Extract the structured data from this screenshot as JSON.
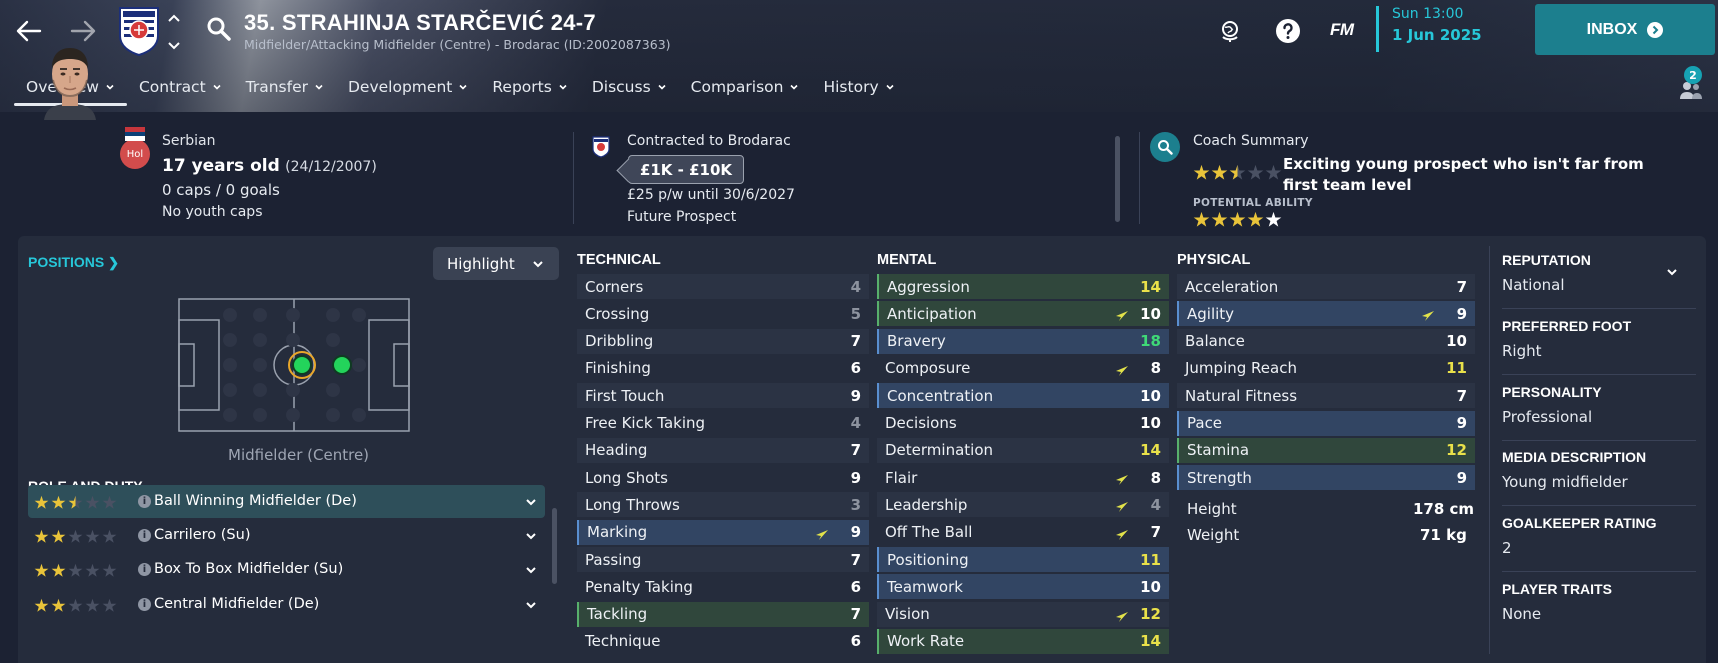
{
  "header": {
    "player_title": "35. STRAHINJA STARČEVIĆ 24-7",
    "player_subtitle": "Midfielder/Attacking Midfielder (Centre) - Brodarac (ID:2002087363)",
    "fm_logo": "FM",
    "date_time": "Sun 13:00",
    "date_day": "1 Jun 2025",
    "inbox_label": "INBOX",
    "notification_count": "2",
    "tabs": [
      {
        "label": "Overview",
        "active": true
      },
      {
        "label": "Contract"
      },
      {
        "label": "Transfer"
      },
      {
        "label": "Development"
      },
      {
        "label": "Reports"
      },
      {
        "label": "Discuss"
      },
      {
        "label": "Comparison"
      },
      {
        "label": "History"
      }
    ]
  },
  "info": {
    "hol_badge": "Hol",
    "nationality": "Serbian",
    "age": "17 years old",
    "dob": "(24/12/2007)",
    "caps": "0 caps / 0 goals",
    "youth_caps": "No youth caps",
    "contracted": "Contracted to Brodarac",
    "wage_range": "£1K - £10K",
    "wage_line": "£25 p/w until 30/6/2027",
    "status": "Future Prospect",
    "coach_summary_label": "Coach Summary",
    "coach_quote": "Exciting young prospect who isn't far from first team level",
    "current_ability_stars": 2.5,
    "potential_label": "POTENTIAL ABILITY",
    "potential_ability_stars": 4.5
  },
  "positions": {
    "link_label": "POSITIONS",
    "highlight_label": "Highlight",
    "position_label": "Midfielder (Centre)",
    "role_title": "ROLE AND DUTY",
    "roles": [
      {
        "name": "Ball Winning Midfielder (De)",
        "stars": 2.5
      },
      {
        "name": "Carrilero (Su)",
        "stars": 2
      },
      {
        "name": "Box To Box Midfielder (Su)",
        "stars": 2
      },
      {
        "name": "Central Midfielder (De)",
        "stars": 2
      }
    ]
  },
  "technical": {
    "title": "TECHNICAL",
    "attrs": [
      {
        "name": "Corners",
        "value": "4"
      },
      {
        "name": "Crossing",
        "value": "5"
      },
      {
        "name": "Dribbling",
        "value": "7"
      },
      {
        "name": "Finishing",
        "value": "6"
      },
      {
        "name": "First Touch",
        "value": "9"
      },
      {
        "name": "Free Kick Taking",
        "value": "4"
      },
      {
        "name": "Heading",
        "value": "7"
      },
      {
        "name": "Long Shots",
        "value": "9"
      },
      {
        "name": "Long Throws",
        "value": "3"
      },
      {
        "name": "Marking",
        "value": "9"
      },
      {
        "name": "Passing",
        "value": "7"
      },
      {
        "name": "Penalty Taking",
        "value": "6"
      },
      {
        "name": "Tackling",
        "value": "7"
      },
      {
        "name": "Technique",
        "value": "6"
      }
    ]
  },
  "mental": {
    "title": "MENTAL",
    "attrs": [
      {
        "name": "Aggression",
        "value": "14"
      },
      {
        "name": "Anticipation",
        "value": "10"
      },
      {
        "name": "Bravery",
        "value": "18"
      },
      {
        "name": "Composure",
        "value": "8"
      },
      {
        "name": "Concentration",
        "value": "10"
      },
      {
        "name": "Decisions",
        "value": "10"
      },
      {
        "name": "Determination",
        "value": "14"
      },
      {
        "name": "Flair",
        "value": "8"
      },
      {
        "name": "Leadership",
        "value": "4"
      },
      {
        "name": "Off The Ball",
        "value": "7"
      },
      {
        "name": "Positioning",
        "value": "11"
      },
      {
        "name": "Teamwork",
        "value": "10"
      },
      {
        "name": "Vision",
        "value": "12"
      },
      {
        "name": "Work Rate",
        "value": "14"
      }
    ]
  },
  "physical": {
    "title": "PHYSICAL",
    "attrs": [
      {
        "name": "Acceleration",
        "value": "7"
      },
      {
        "name": "Agility",
        "value": "9"
      },
      {
        "name": "Balance",
        "value": "10"
      },
      {
        "name": "Jumping Reach",
        "value": "11"
      },
      {
        "name": "Natural Fitness",
        "value": "7"
      },
      {
        "name": "Pace",
        "value": "9"
      },
      {
        "name": "Stamina",
        "value": "12"
      },
      {
        "name": "Strength",
        "value": "9"
      }
    ],
    "height_label": "Height",
    "height_value": "178 cm",
    "weight_label": "Weight",
    "weight_value": "71 kg"
  },
  "sidebar": {
    "items": [
      {
        "title": "REPUTATION",
        "value": "National"
      },
      {
        "title": "PREFERRED FOOT",
        "value": "Right"
      },
      {
        "title": "PERSONALITY",
        "value": "Professional"
      },
      {
        "title": "MEDIA DESCRIPTION",
        "value": "Young midfielder"
      },
      {
        "title": "GOALKEEPER RATING",
        "value": "2"
      },
      {
        "title": "PLAYER TRAITS",
        "value": "None"
      }
    ]
  },
  "colors": {
    "accent": "#27c7d9",
    "inbox": "#1c7f8e",
    "star": "#e9c43a",
    "green_value": "#3fd977",
    "yellow_value": "#e9e14a"
  }
}
